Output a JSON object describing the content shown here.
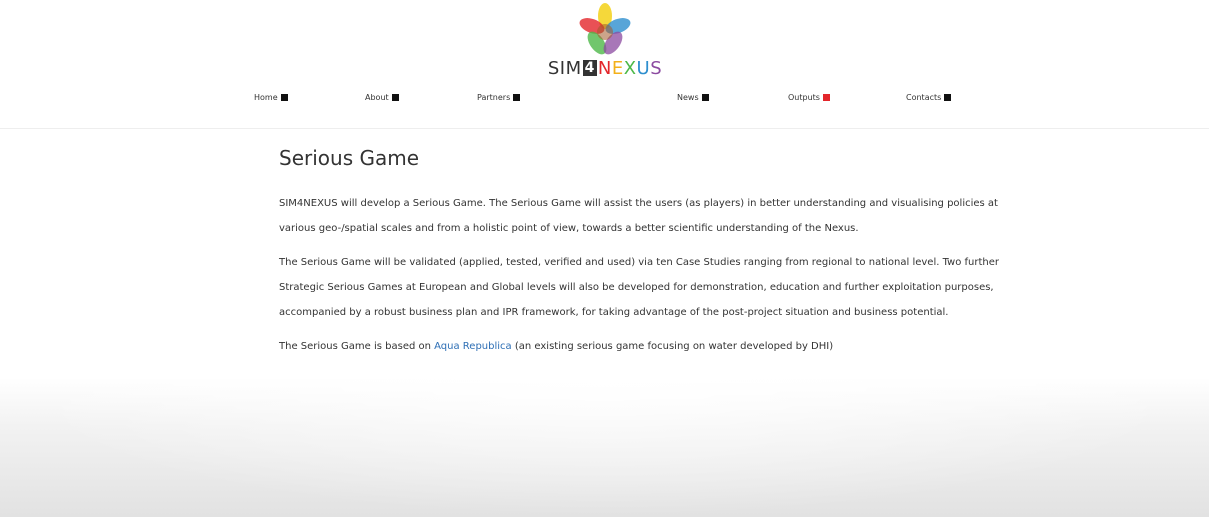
{
  "logo": {
    "sim": "SIM",
    "four": "4",
    "n": "N",
    "e": "E",
    "x": "X",
    "u": "U",
    "s": "S"
  },
  "nav": {
    "items": [
      {
        "label": "Home",
        "square_color": "#111111"
      },
      {
        "label": "About",
        "square_color": "#111111"
      },
      {
        "label": "Partners",
        "square_color": "#111111"
      },
      {
        "label": "News",
        "square_color": "#111111"
      },
      {
        "label": "Outputs",
        "square_color": "#e3262b"
      },
      {
        "label": "Contacts",
        "square_color": "#111111"
      }
    ]
  },
  "main": {
    "title": "Serious Game",
    "p1": [
      "SIM4NEXUS will develop a Serious Game. The Serious Game will assist the users (as players) in better understanding and visualising policies at",
      "various geo-/spatial scales and from a holistic point of view, towards a better scientific understanding of the Nexus."
    ],
    "p2": [
      "The Serious Game will be validated (applied, tested, verified and used) via ten Case Studies ranging from regional to national level. Two further",
      "Strategic Serious Games at European and Global levels will also be developed for demonstration, education and further exploitation purposes,",
      "accompanied by a robust business plan and IPR framework, for taking advantage of the post-project situation and business potential."
    ],
    "p3": {
      "before": "The Serious Game is based on ",
      "link": "Aqua Republica",
      "after": " (an existing serious game focusing on water developed by DHI)"
    }
  },
  "colors": {
    "accent_red": "#e3262b",
    "link_blue": "#2e6fb5",
    "text": "#333333"
  }
}
